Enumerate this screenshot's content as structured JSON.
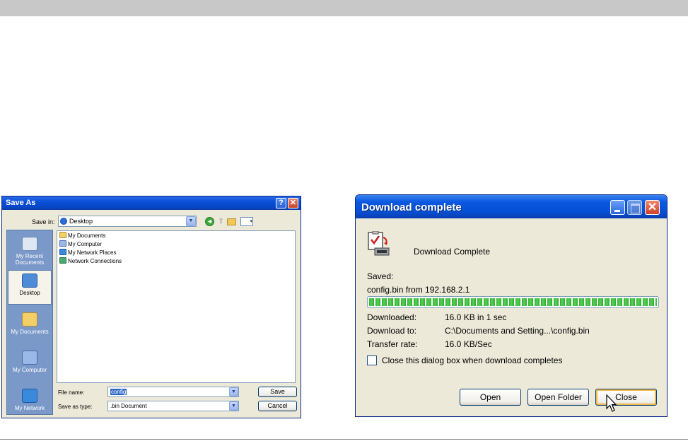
{
  "save_as": {
    "title": "Save As",
    "help_glyph": "?",
    "close_glyph": "✕",
    "save_in_label": "Save in:",
    "save_in_value": "Desktop",
    "places": [
      {
        "label": "My Recent Documents",
        "icon": "recent-documents-icon"
      },
      {
        "label": "Desktop",
        "icon": "desktop-icon"
      },
      {
        "label": "My Documents",
        "icon": "my-documents-icon"
      },
      {
        "label": "My Computer",
        "icon": "my-computer-icon"
      },
      {
        "label": "My Network",
        "icon": "my-network-icon"
      }
    ],
    "files": [
      "My Documents",
      "My Computer",
      "My Network Places",
      "Network Connections"
    ],
    "file_name_label": "File name:",
    "file_name_value": "config",
    "save_type_label": "Save as type:",
    "save_type_value": ".bin Document",
    "save_button": "Save",
    "cancel_button": "Cancel"
  },
  "download": {
    "title": "Download complete",
    "close_glyph": "✕",
    "heading": "Download Complete",
    "saved_label": "Saved:",
    "saved_value": "config.bin from 192.168.2.1",
    "progress": 1.0,
    "downloaded_label": "Downloaded:",
    "downloaded_value": "16.0 KB in 1 sec",
    "download_to_label": "Download to:",
    "download_to_value": "C:\\Documents and Setting...\\config.bin",
    "transfer_rate_label": "Transfer rate:",
    "transfer_rate_value": "16.0 KB/Sec",
    "close_when_done_label": "Close this dialog box when download completes",
    "close_when_done_checked": false,
    "open_button": "Open",
    "open_folder_button": "Open Folder",
    "close_button": "Close"
  }
}
